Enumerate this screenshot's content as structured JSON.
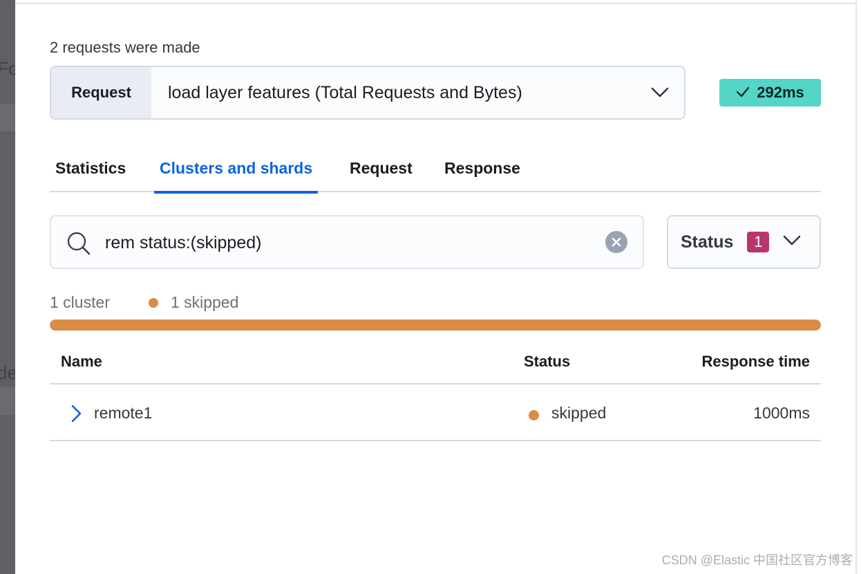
{
  "request_count_text": "2 requests were made",
  "request_select": {
    "prepend_label": "Request",
    "value": "load layer features (Total Requests and Bytes)"
  },
  "time_badge": {
    "icon": "check-icon",
    "text": "292ms",
    "color": "#54d5c7"
  },
  "tabs": [
    {
      "label": "Statistics",
      "active": false
    },
    {
      "label": "Clusters and shards",
      "active": true
    },
    {
      "label": "Request",
      "active": false
    },
    {
      "label": "Response",
      "active": false
    }
  ],
  "search": {
    "value": "rem status:(skipped)",
    "icon": "search-icon",
    "clear_icon": "clear-icon"
  },
  "status_filter": {
    "label": "Status",
    "count": "1",
    "count_color": "#b9356c"
  },
  "summary": {
    "clusters_text": "1 cluster",
    "skipped_text": "1 skipped",
    "skipped_color": "#da8b45",
    "skipped_fraction": 1.0
  },
  "table": {
    "headers": {
      "name": "Name",
      "status": "Status",
      "response_time": "Response time"
    },
    "rows": [
      {
        "name": "remote1",
        "status": "skipped",
        "response_time": "1000ms"
      }
    ]
  },
  "backdrop": {
    "ghost_text_1": "Fo",
    "ghost_text_2": "de"
  },
  "watermark": "CSDN @Elastic 中国社区官方博客"
}
